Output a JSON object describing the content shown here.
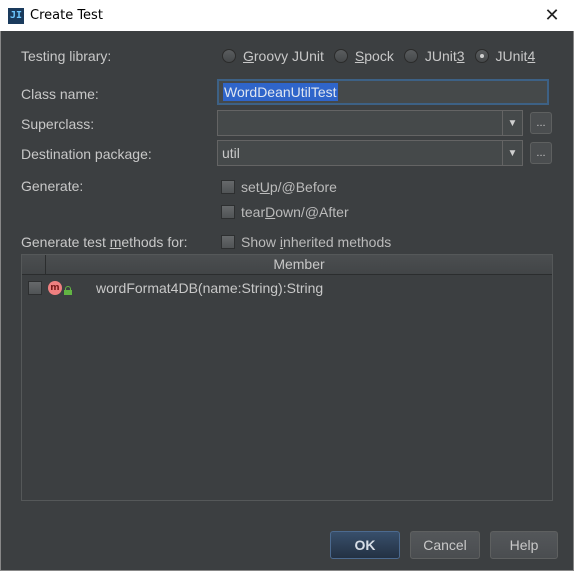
{
  "window": {
    "title": "Create Test",
    "app_icon_text": "JI",
    "close_glyph": "✕"
  },
  "testing_library": {
    "label_pre": "Testing library:",
    "options": [
      {
        "pre": "",
        "u": "G",
        "post": "roovy JUnit",
        "selected": false
      },
      {
        "pre": "",
        "u": "S",
        "post": "pock",
        "selected": false
      },
      {
        "pre": "JUnit",
        "u": "3",
        "post": "",
        "selected": false
      },
      {
        "pre": "JUnit",
        "u": "4",
        "post": "",
        "selected": true
      }
    ]
  },
  "class_name": {
    "label": "Class name:",
    "value": "WordDeanUtilTest"
  },
  "superclass": {
    "label": "Superclass:",
    "value": "",
    "ellipsis": "..."
  },
  "destination_package": {
    "label": "Destination package:",
    "value": "util",
    "ellipsis": "..."
  },
  "generate": {
    "label": "Generate:",
    "setup": {
      "pre": "set",
      "u": "U",
      "post": "p/@Before"
    },
    "teardown": {
      "pre": "tear",
      "u": "D",
      "post": "own/@After"
    }
  },
  "generate_methods": {
    "label_pre": "Generate test ",
    "label_u": "m",
    "label_post": "ethods for:",
    "show_inherited": {
      "pre": "Show ",
      "u": "i",
      "post": "nherited methods"
    }
  },
  "table": {
    "header": "Member",
    "rows": [
      {
        "method_icon": "m",
        "name": "wordFormat4DB(name:String):String"
      }
    ]
  },
  "buttons": {
    "ok": "OK",
    "cancel": "Cancel",
    "help": "Help"
  },
  "colors": {
    "background": "#3c3f41",
    "selection": "#2f65ca",
    "accent_focus": "#3d6185",
    "method_icon": "#f08080",
    "lock_icon": "#62b543"
  }
}
